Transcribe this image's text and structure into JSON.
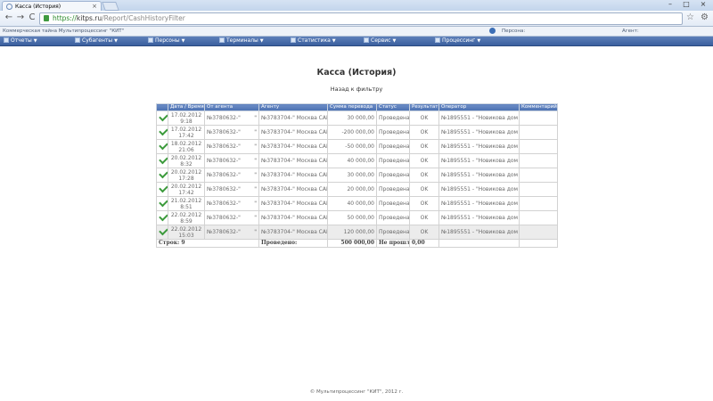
{
  "browser": {
    "tab_title": "Касса (История)",
    "tab_close": "×",
    "url_protocol": "https://",
    "url_host": "kitps.ru",
    "url_path": "/Report/CashHistoryFilter",
    "min_label": "–",
    "max_label": "□",
    "close_label": "×",
    "back_label": "←",
    "forward_label": "→",
    "reload_label": "C",
    "star_label": "☆",
    "wrench_label": "⚙"
  },
  "header": {
    "company": "Коммерческая тайна Мультипроцессинг \"КИТ\"",
    "person_label": "Персона:",
    "agent_label": "Агент:"
  },
  "menu": {
    "items": [
      {
        "label": "Отчеты"
      },
      {
        "label": "Субагенты"
      },
      {
        "label": "Персоны"
      },
      {
        "label": "Терминалы"
      },
      {
        "label": "Статистика"
      },
      {
        "label": "Сервис"
      },
      {
        "label": "Процессинг"
      }
    ]
  },
  "page": {
    "title": "Касса (История)",
    "back_link": "Назад к фильтру"
  },
  "table": {
    "columns": [
      "",
      "Дата / Время",
      "От агента",
      "Агенту",
      "Сумма перевода",
      "Статус",
      "Результат",
      "Оператор",
      "Комментарий"
    ],
    "rows": [
      {
        "date": "17.02.2012",
        "time": "9:18",
        "from": "№3780632-\"",
        "from2": "\"",
        "to": "№3783704-\" Москва САВ\"",
        "amount": "30 000,00",
        "status": "Проведена",
        "result": "OK",
        "operator": "№1895551 - \"Новикова дом \"",
        "comment": ""
      },
      {
        "date": "17.02.2012",
        "time": "17:42",
        "from": "№3780632-\"",
        "from2": "\"",
        "to": "№3783704-\" Москва САВ\"",
        "amount": "-200 000,00",
        "status": "Проведена",
        "result": "OK",
        "operator": "№1895551 - \"Новикова дом \"",
        "comment": ""
      },
      {
        "date": "18.02.2012",
        "time": "21:06",
        "from": "№3780632-\"",
        "from2": "\"",
        "to": "№3783704-\" Москва САВ\"",
        "amount": "-50 000,00",
        "status": "Проведена",
        "result": "OK",
        "operator": "№1895551 - \"Новикова дом \"",
        "comment": ""
      },
      {
        "date": "20.02.2012",
        "time": "8:32",
        "from": "№3780632-\"",
        "from2": "\"",
        "to": "№3783704-\" Москва САВ\"",
        "amount": "40 000,00",
        "status": "Проведена",
        "result": "OK",
        "operator": "№1895551 - \"Новикова дом \"",
        "comment": ""
      },
      {
        "date": "20.02.2012",
        "time": "17:28",
        "from": "№3780632-\"",
        "from2": "\"",
        "to": "№3783704-\" Москва САВ\"",
        "amount": "30 000,00",
        "status": "Проведена",
        "result": "OK",
        "operator": "№1895551 - \"Новикова дом \"",
        "comment": ""
      },
      {
        "date": "20.02.2012",
        "time": "17:42",
        "from": "№3780632-\"",
        "from2": "\"",
        "to": "№3783704-\" Москва САВ\"",
        "amount": "20 000,00",
        "status": "Проведена",
        "result": "OK",
        "operator": "№1895551 - \"Новикова дом \"",
        "comment": ""
      },
      {
        "date": "21.02.2012",
        "time": "8:51",
        "from": "№3780632-\"",
        "from2": "\"",
        "to": "№3783704-\" Москва САВ\"",
        "amount": "40 000,00",
        "status": "Проведена",
        "result": "OK",
        "operator": "№1895551 - \"Новикова дом \"",
        "comment": ""
      },
      {
        "date": "22.02.2012",
        "time": "8:59",
        "from": "№3780632-\"",
        "from2": "\"",
        "to": "№3783704-\" Москва САВ\"",
        "amount": "50 000,00",
        "status": "Проведена",
        "result": "OK",
        "operator": "№1895551 - \"Новикова дом \"",
        "comment": ""
      },
      {
        "date": "22.02.2012",
        "time": "15:03",
        "from": "№3780632-\"",
        "from2": "\"",
        "to": "№3783704-\" Москва САВ\"",
        "amount": "120 000,00",
        "status": "Проведена",
        "result": "OK",
        "operator": "№1895551 - \"Новикова дом \"",
        "comment": ""
      }
    ],
    "footer": {
      "rows_label": "Строк: 9",
      "done_label": "Проведено:",
      "done_value": "500 000,00",
      "failed_label": "Не прошло:",
      "failed_value": "0,00"
    }
  },
  "footer": {
    "copyright": "© Мультипроцессинг \"КИТ\", 2012 г."
  },
  "colors": {
    "menu_bar": "#4a6fb0",
    "table_header": "#5a7cbc",
    "check": "#3b9a3b"
  }
}
